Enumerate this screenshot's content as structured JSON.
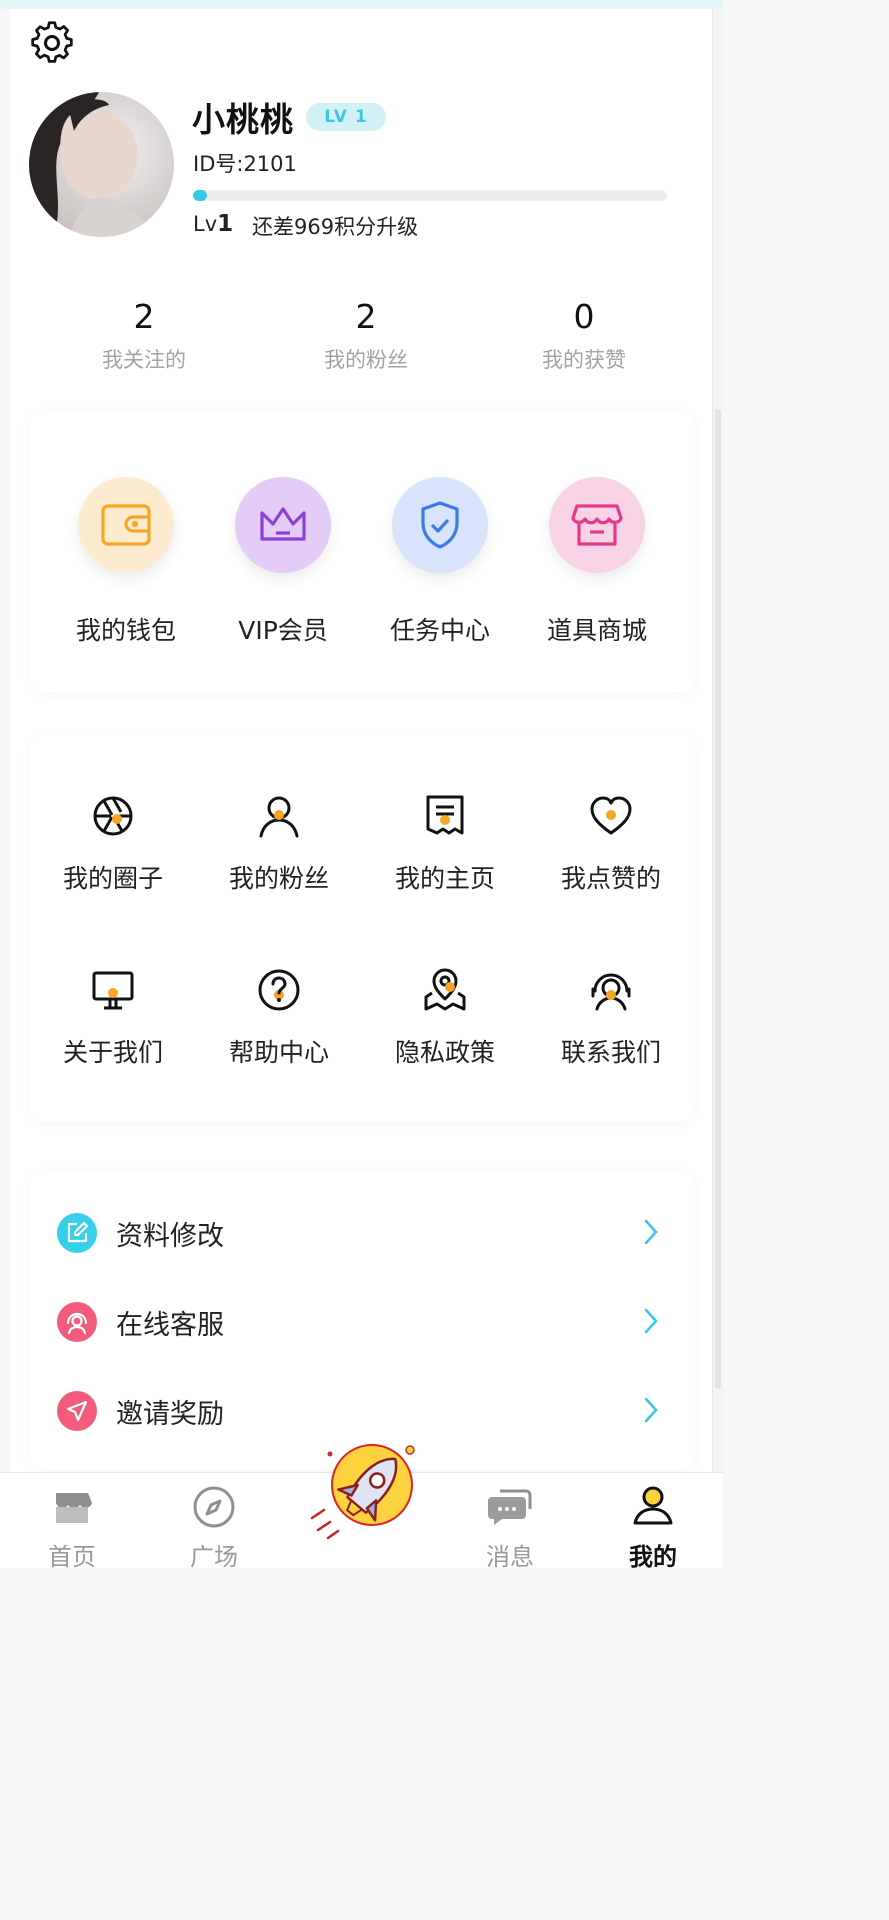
{
  "profile": {
    "nickname": "小桃桃",
    "level_badge": "LV 1",
    "uid": "ID号:2101",
    "progress": 0.03,
    "lv_prefix": "Lv",
    "lv_value": "1",
    "upgrade_hint": "还差969积分升级"
  },
  "stats": [
    {
      "value": "2",
      "label": "我关注的"
    },
    {
      "value": "2",
      "label": "我的粉丝"
    },
    {
      "value": "0",
      "label": "我的获赞"
    }
  ],
  "quick_actions": [
    {
      "label": "我的钱包",
      "icon": "wallet-icon",
      "color": "#f5a623",
      "bg": "#fdebd0"
    },
    {
      "label": "VIP会员",
      "icon": "crown-icon",
      "color": "#8a3fd6",
      "bg": "#e3cdf7"
    },
    {
      "label": "任务中心",
      "icon": "shield-check-icon",
      "color": "#3a7be8",
      "bg": "#d7e4fb"
    },
    {
      "label": "道具商城",
      "icon": "shop-icon",
      "color": "#e5398c",
      "bg": "#f8d3e6"
    }
  ],
  "features": [
    {
      "label": "我的圈子",
      "icon": "aperture-icon"
    },
    {
      "label": "我的粉丝",
      "icon": "user-icon"
    },
    {
      "label": "我的主页",
      "icon": "document-icon"
    },
    {
      "label": "我点赞的",
      "icon": "heart-icon"
    },
    {
      "label": "关于我们",
      "icon": "monitor-icon"
    },
    {
      "label": "帮助中心",
      "icon": "help-icon"
    },
    {
      "label": "隐私政策",
      "icon": "map-pin-icon"
    },
    {
      "label": "联系我们",
      "icon": "headset-icon"
    }
  ],
  "menu": [
    {
      "label": "资料修改",
      "icon": "edit-icon",
      "color": "#36d0ea"
    },
    {
      "label": "在线客服",
      "icon": "support-icon",
      "color": "#f25b7b"
    },
    {
      "label": "邀请奖励",
      "icon": "send-icon",
      "color": "#f25b7b"
    }
  ],
  "tabs": [
    {
      "label": "首页",
      "icon": "home-store-icon",
      "active": false
    },
    {
      "label": "广场",
      "icon": "compass-icon",
      "active": false
    },
    {
      "label": "消息",
      "icon": "chat-icon",
      "active": false
    },
    {
      "label": "我的",
      "icon": "profile-icon",
      "active": true
    }
  ],
  "colors": {
    "accent": "#36c8e6",
    "icon_dot": "#f5a623",
    "arrow": "#36c8e6"
  }
}
